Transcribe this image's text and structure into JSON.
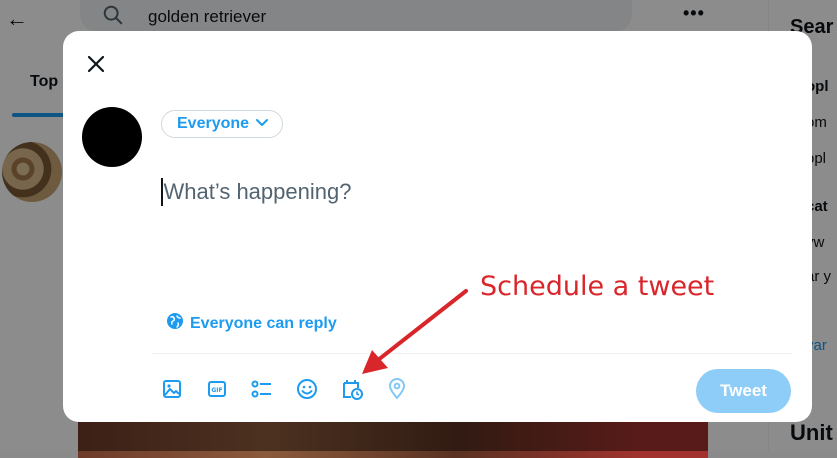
{
  "background": {
    "search_query": "golden retriever",
    "active_tab": "Top",
    "right_title": "Sear",
    "right_lines": [
      {
        "text": "opl",
        "bold": true
      },
      {
        "text": "om",
        "bold": false
      },
      {
        "text": "opl",
        "bold": false
      },
      {
        "text": "cat",
        "bold": true
      },
      {
        "text": "yw",
        "bold": false
      },
      {
        "text": "ar y",
        "bold": false
      },
      {
        "text": "var",
        "link": true
      }
    ],
    "right_bottom": "Unit"
  },
  "compose": {
    "audience_label": "Everyone",
    "placeholder": "What’s happening?",
    "reply_setting": "Everyone can reply",
    "tweet_button": "Tweet",
    "toolbar": [
      "image-icon",
      "gif-icon",
      "poll-icon",
      "emoji-icon",
      "schedule-icon",
      "location-icon"
    ]
  },
  "annotation": {
    "text": "Schedule a tweet",
    "color": "#d9262b"
  },
  "colors": {
    "accent": "#1d9bf0",
    "tweet_disabled": "#8ecdf8",
    "overlay": "rgba(0,0,0,0.45)"
  }
}
